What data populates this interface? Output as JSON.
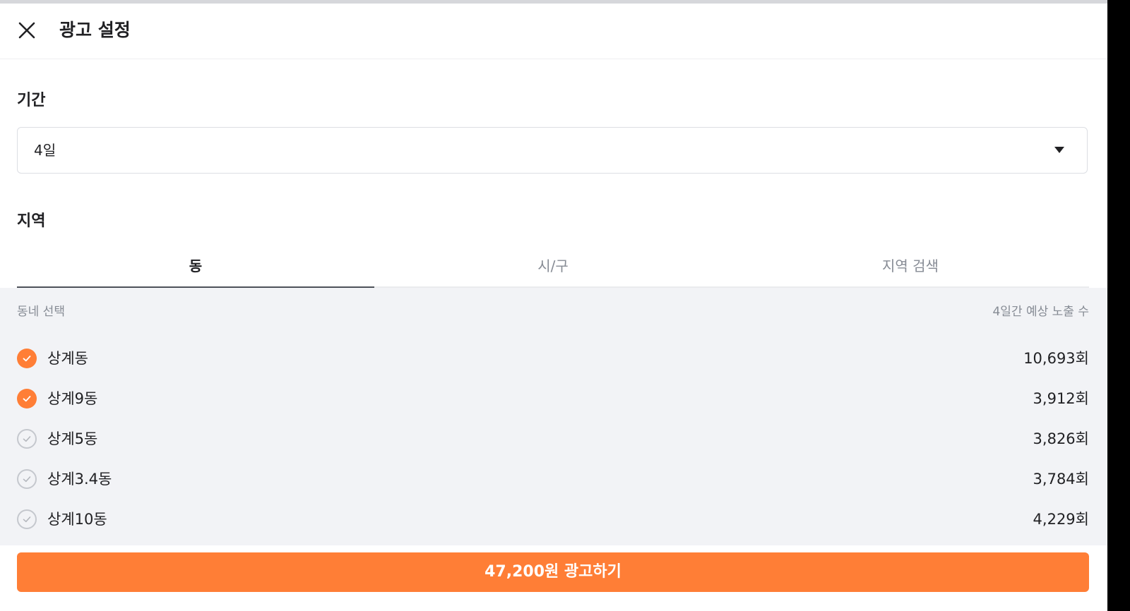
{
  "header": {
    "title": "광고 설정",
    "close_icon": "close-icon"
  },
  "period": {
    "label": "기간",
    "selected": "4일",
    "arrow_icon": "dropdown-arrow-icon"
  },
  "region": {
    "label": "지역",
    "tabs": [
      {
        "label": "동",
        "active": true
      },
      {
        "label": "시/구",
        "active": false
      },
      {
        "label": "지역 검색",
        "active": false
      }
    ]
  },
  "list": {
    "left_header": "동네 선택",
    "right_header": "4일간 예상 노출 수",
    "items": [
      {
        "name": "상계동",
        "exposure": "10,693회",
        "checked": true
      },
      {
        "name": "상계9동",
        "exposure": "3,912회",
        "checked": true
      },
      {
        "name": "상계5동",
        "exposure": "3,826회",
        "checked": false
      },
      {
        "name": "상계3.4동",
        "exposure": "3,784회",
        "checked": false
      },
      {
        "name": "상계10동",
        "exposure": "4,229회",
        "checked": false
      }
    ]
  },
  "cta": {
    "label": "47,200원  광고하기"
  },
  "colors": {
    "accent": "#ff7e36",
    "text": "#212124",
    "muted": "#868b94",
    "panel": "#f2f3f6"
  }
}
